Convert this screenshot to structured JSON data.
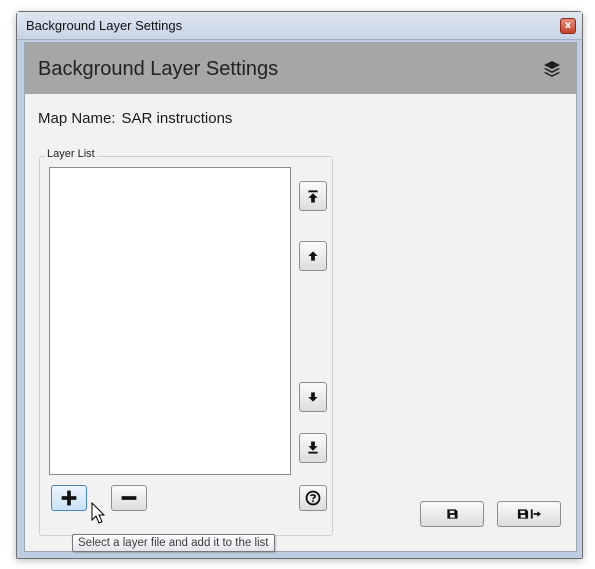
{
  "window": {
    "title": "Background Layer Settings",
    "close_glyph": "x"
  },
  "header": {
    "title": "Background Layer Settings",
    "icon": "layers-icon"
  },
  "map_name": {
    "label": "Map Name:",
    "value": "SAR instructions"
  },
  "layer_list": {
    "group_label": "Layer List",
    "items": []
  },
  "buttons": {
    "move_top": "move-to-top-icon",
    "move_up": "move-up-icon",
    "move_down": "move-down-icon",
    "move_bottom": "move-to-bottom-icon",
    "add": "plus-icon",
    "remove": "minus-icon",
    "help": "question-icon",
    "save": "save-icon",
    "save_exit": "save-and-exit-icon"
  },
  "tooltip": {
    "text": "Select a layer file and add it to the list"
  },
  "colors": {
    "header_band": "#a6a6a6",
    "client_bg": "#f2f2f2",
    "titlebar": "#c7d4e6",
    "close_button": "#c2432b",
    "add_button_focus": "#4a86c5"
  }
}
